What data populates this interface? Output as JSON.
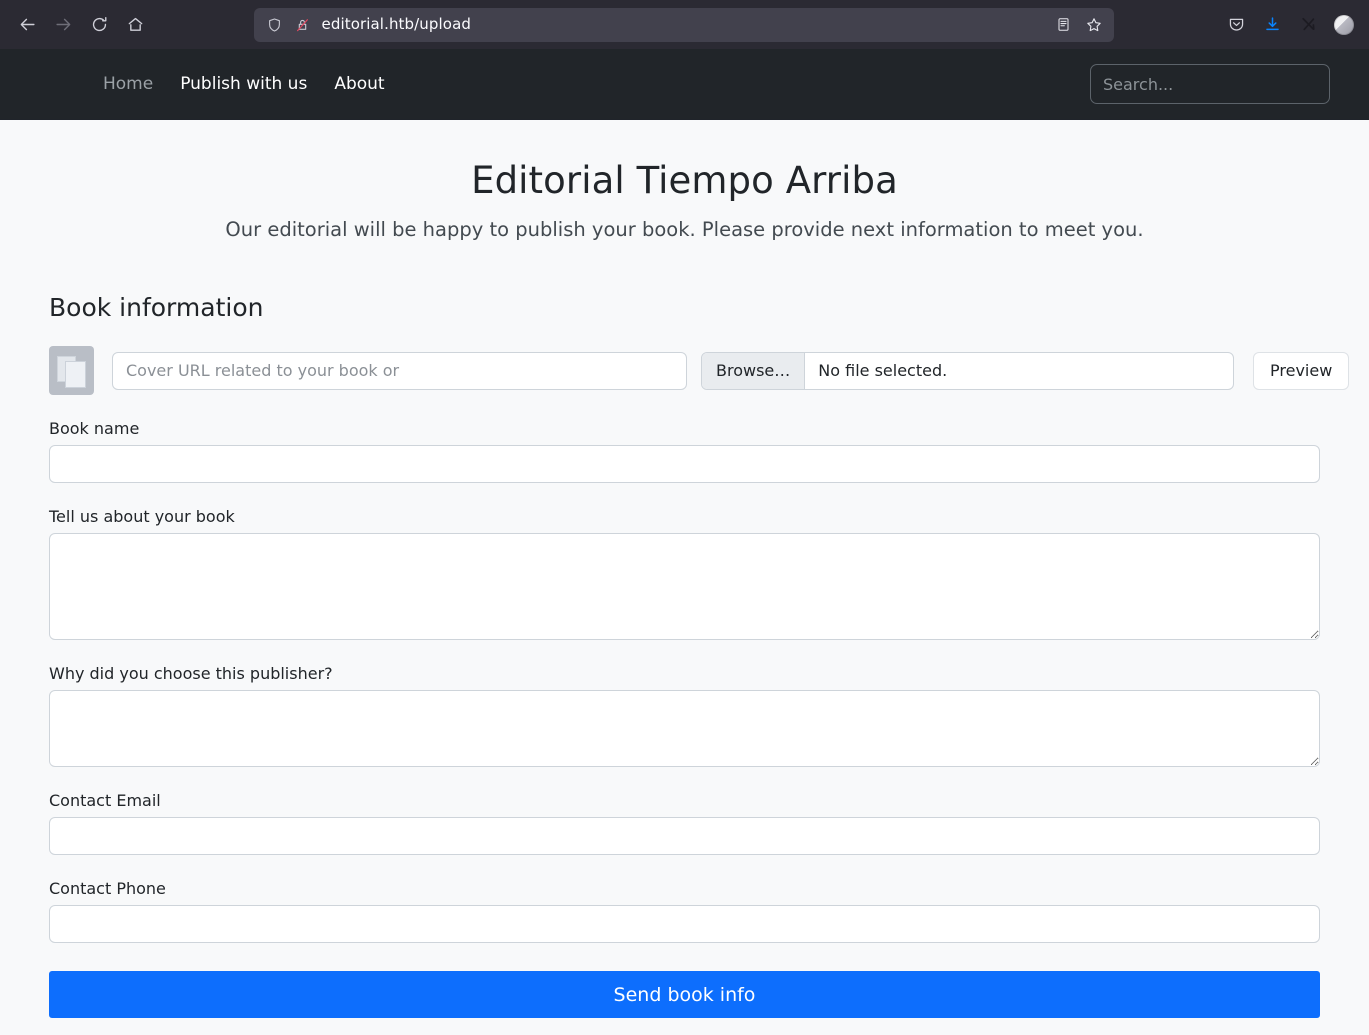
{
  "browser": {
    "back_label": "Back",
    "forward_label": "Forward",
    "reload_label": "Reload",
    "home_label": "Home",
    "url": "editorial.htb/upload",
    "shield_label": "Tracking protection",
    "lock_label": "Connection is not secure",
    "reader_label": "Toggle reader view",
    "bookmark_label": "Bookmark this page",
    "pocket_label": "Save to Pocket",
    "downloads_label": "Downloads",
    "extension_label": "Extension",
    "account_label": "Account"
  },
  "site_nav": {
    "links": [
      {
        "label": "Home",
        "muted": true
      },
      {
        "label": "Publish with us",
        "muted": false
      },
      {
        "label": "About",
        "muted": false
      }
    ],
    "search_placeholder": "Search...",
    "search_value": ""
  },
  "hero": {
    "title": "Editorial Tiempo Arriba",
    "subtitle": "Our editorial will be happy to publish your book. Please provide next information to meet you."
  },
  "form": {
    "section_title": "Book information",
    "cover_url_placeholder": "Cover URL related to your book or",
    "cover_url_value": "",
    "browse_label": "Browse…",
    "file_status": "No file selected.",
    "preview_label": "Preview",
    "book_name_label": "Book name",
    "book_name_value": "",
    "about_label": "Tell us about your book",
    "about_value": "",
    "why_label": "Why did you choose this publisher?",
    "why_value": "",
    "email_label": "Contact Email",
    "email_value": "",
    "phone_label": "Contact Phone",
    "phone_value": "",
    "submit_label": "Send book info"
  },
  "colors": {
    "chrome_bg": "#2b2a33",
    "urlbar_bg": "#42414d",
    "site_nav_bg": "#212529",
    "page_bg": "#f8f9fa",
    "primary": "#0d6efd",
    "border": "#ced4da",
    "download_accent": "#0a84ff"
  }
}
